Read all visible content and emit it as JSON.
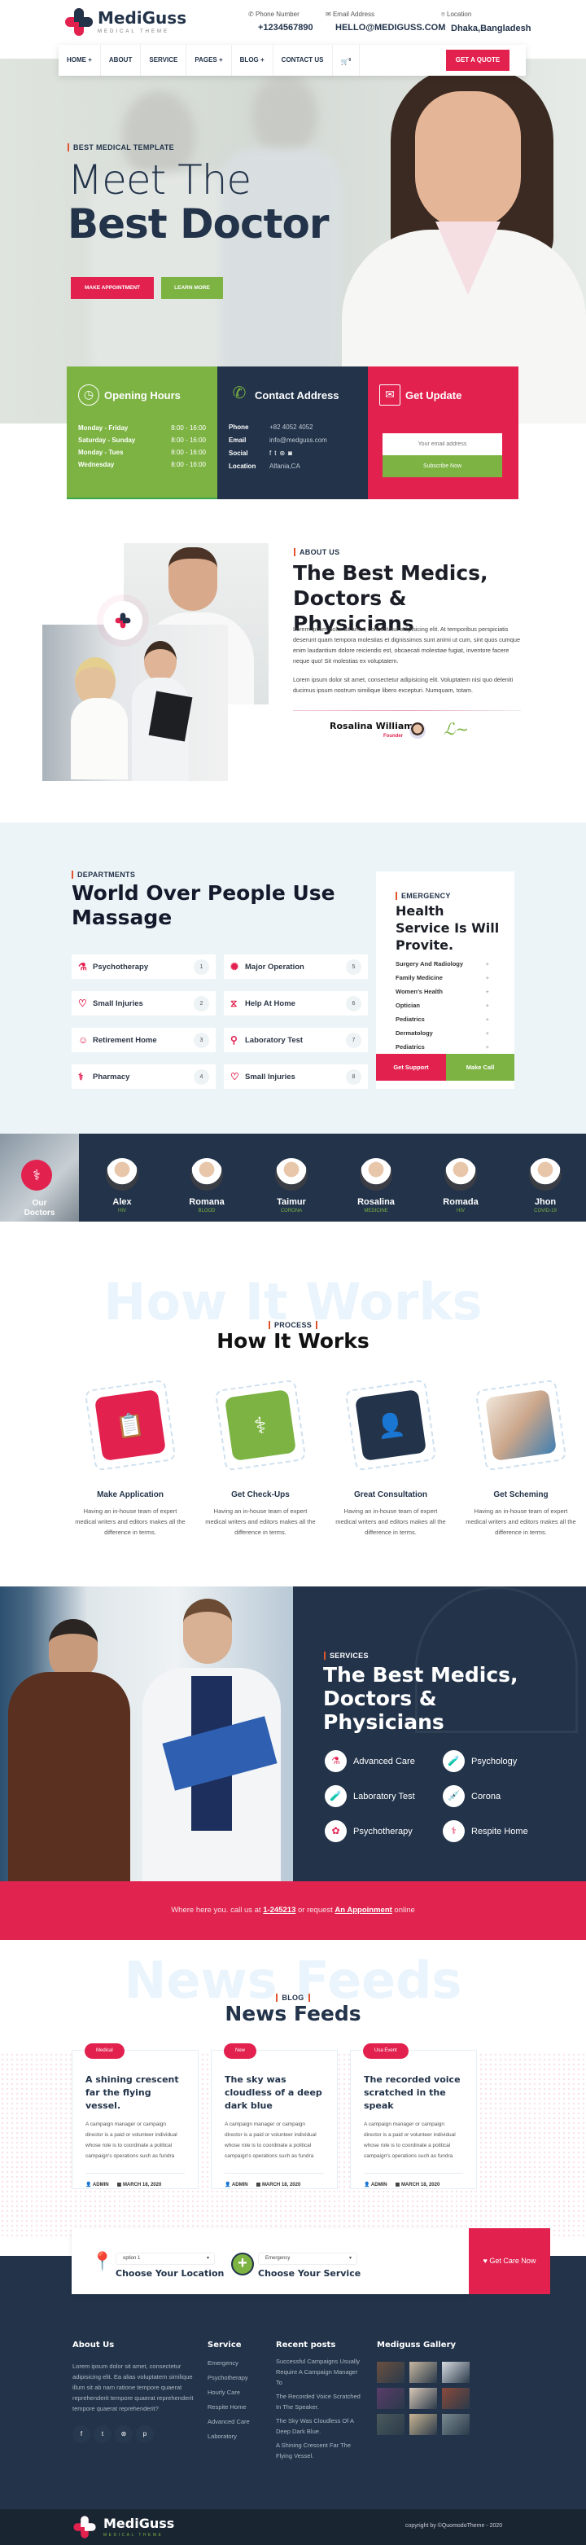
{
  "brand": {
    "name": "MediGuss",
    "tagline": "MEDICAL THEME"
  },
  "header": {
    "phone": {
      "label": "Phone Number",
      "value": "+1234567890"
    },
    "email": {
      "label": "Email Address",
      "value": "HELLO@MEDIGUSS.COM"
    },
    "location": {
      "label": "Location",
      "value": "Dhaka,Bangladesh"
    },
    "nav": [
      "HOME +",
      "ABOUT",
      "SERVICE",
      "PAGES +",
      "BLOG +",
      "CONTACT US"
    ],
    "cart_count": "0",
    "quote_button": "GET A QUOTE"
  },
  "hero": {
    "tag": "BEST MEDICAL TEMPLATE",
    "title_light": "Meet The",
    "title_bold": "Best Doctor",
    "primary_button": "MAKE APPOINTMENT",
    "secondary_button": "LEARN MORE"
  },
  "info": {
    "hours": {
      "title": "Opening Hours",
      "rows": [
        {
          "day": "Monday - Friday",
          "time": "8:00 - 16:00"
        },
        {
          "day": "Saturday - Sunday",
          "time": "8:00 - 16:00"
        },
        {
          "day": "Monday - Tues",
          "time": "8:00 - 16:00"
        },
        {
          "day": "Wednesday",
          "time": "8:00 - 16:00"
        }
      ]
    },
    "contact": {
      "title": "Contact Address",
      "rows": [
        {
          "label": "Phone",
          "value": "+82 4052 4052"
        },
        {
          "label": "Email",
          "value": "info@medguss.com"
        },
        {
          "label": "Social",
          "value": ""
        },
        {
          "label": "Location",
          "value": "Alfania,CA"
        }
      ]
    },
    "update": {
      "title": "Get Update",
      "placeholder": "Your email address",
      "button": "Subscribe Now"
    }
  },
  "about": {
    "tag": "ABOUT US",
    "title": "The Best Medics, Doctors & Physicians",
    "p1": "Lorem ipsum dolor sit amet, consectetur adipisicing elit. At temporibus perspiciatis deserunt quam tempora molestias et dignissimos sunt animi ut cum, sint quos cumque enim laudantium dolore reiciendis est, obcaecati molestiae fugiat, inventore facere neque quo! Sit molestias ex voluptatem.",
    "p2": "Lorem ipsum dolor sit amet, consectetur adipisicing elit. Voluptatem nisi quo deleniti ducimus ipsum nostrum similique libero excepturi. Numquam, totam.",
    "founder_name": "Rosalina William",
    "founder_role": "Founder"
  },
  "departments": {
    "tag": "DEPARTMENTS",
    "title": "World Over People Use Massage",
    "items": [
      {
        "label": "Psychotherapy",
        "num": "1"
      },
      {
        "label": "Small Injuries",
        "num": "2"
      },
      {
        "label": "Retirement Home",
        "num": "3"
      },
      {
        "label": "Pharmacy",
        "num": "4"
      },
      {
        "label": "Major Operation",
        "num": "5"
      },
      {
        "label": "Help At Home",
        "num": "6"
      },
      {
        "label": "Laboratory Test",
        "num": "7"
      },
      {
        "label": "Small Injuries",
        "num": "8"
      }
    ]
  },
  "emergency": {
    "tag": "EMERGENCY",
    "title": "Health Service Is Will Provite.",
    "items": [
      "Surgery And Radiology",
      "Family Medicine",
      "Women's Health",
      "Optician",
      "Pediatrics",
      "Dermatology",
      "Pediatrics"
    ],
    "support_button": "Get Support",
    "call_button": "Make Call"
  },
  "doctors": {
    "label": "Our Doctors",
    "list": [
      {
        "name": "Alex",
        "spec": "HIV"
      },
      {
        "name": "Romana",
        "spec": "BLOOD"
      },
      {
        "name": "Taimur",
        "spec": "CORONA"
      },
      {
        "name": "Rosalina",
        "spec": "MEDICINE"
      },
      {
        "name": "Romada",
        "spec": "HIV"
      },
      {
        "name": "Jhon",
        "spec": "COVID-19"
      }
    ]
  },
  "process": {
    "ghost": "How It Works",
    "tag": "PROCESS",
    "title": "How It Works",
    "steps": [
      {
        "title": "Make Application",
        "text": "Having an in-house team of expert medical writers and editors makes all the difference in terms."
      },
      {
        "title": "Get Check-Ups",
        "text": "Having an in-house team of expert medical writers and editors makes all the difference in terms."
      },
      {
        "title": "Great Consultation",
        "text": "Having an in-house team of expert medical writers and editors makes all the difference in terms."
      },
      {
        "title": "Get Scheming",
        "text": "Having an in-house team of expert medical writers and editors makes all the difference in terms."
      }
    ]
  },
  "services": {
    "tag": "SERVICES",
    "title": "The Best Medics, Doctors & Physicians",
    "items": [
      "Advanced Care",
      "Psychology",
      "Laboratory Test",
      "Corona",
      "Psychotherapy",
      "Respite Home"
    ]
  },
  "banner": {
    "pre": "Where here you. call us at",
    "phone": "1-245213",
    "mid": "or request",
    "link": "An Appoinment",
    "post": "online"
  },
  "news": {
    "ghost": "News Feeds",
    "tag": "BLOG",
    "title": "News Feeds",
    "posts": [
      {
        "category": "Medical",
        "title": "A shining crescent far the flying vessel.",
        "excerpt": "A campaign manager or campaign director is a paid or volunteer individual whose role is to coordinate a political campaign's operations such as fundra",
        "author": "ADMIN",
        "date": "MARCH 18, 2020"
      },
      {
        "category": "New",
        "title": "The sky was cloudless of a deep dark blue",
        "excerpt": "A campaign manager or campaign director is a paid or volunteer individual whose role is to coordinate a political campaign's operations such as fundra",
        "author": "ADMIN",
        "date": "MARCH 18, 2020"
      },
      {
        "category": "Usa Event",
        "title": "The recorded voice scratched in the speak",
        "excerpt": "A campaign manager or campaign director is a paid or volunteer individual whose role is to coordinate a political campaign's operations such as fundra",
        "author": "ADMIN",
        "date": "MARCH 18, 2020"
      }
    ]
  },
  "choose": {
    "location_select": "option 1",
    "location_label": "Choose Your Location",
    "service_select": "Emergency",
    "service_label": "Choose Your Service",
    "cta": "Get Care Now"
  },
  "footer": {
    "about": {
      "title": "About Us",
      "text": "Lorem ipsum dolor sit amet, consectetur adipisicing elit. Ea alias voluptatem similique illum sit ab nam ratione tempore quaerat reprehenderit tempore quaerat reprehenderit tempore quaerat reprehenderit?"
    },
    "service": {
      "title": "Service",
      "links": [
        "Emergency",
        "Psychotherapy",
        "Hourly Care",
        "Respite Home",
        "Advanced Care",
        "Laboratory"
      ]
    },
    "recent": {
      "title": "Recent posts",
      "links": [
        "Successful Campaigns Usually Require A Campaign Manager To",
        "The Recorded Voice Scratched In The Speaker.",
        "The Sky Was Cloudless Of A Deep Dark Blue.",
        "A Shining Crescent Far The Flying Vessel."
      ]
    },
    "gallery": {
      "title": "Mediguss Gallery"
    },
    "copyright": "copyright by ©QuomodoTheme - 2020"
  },
  "colors": {
    "red": "#e2214f",
    "green": "#7cb342",
    "navy": "#22334a"
  }
}
